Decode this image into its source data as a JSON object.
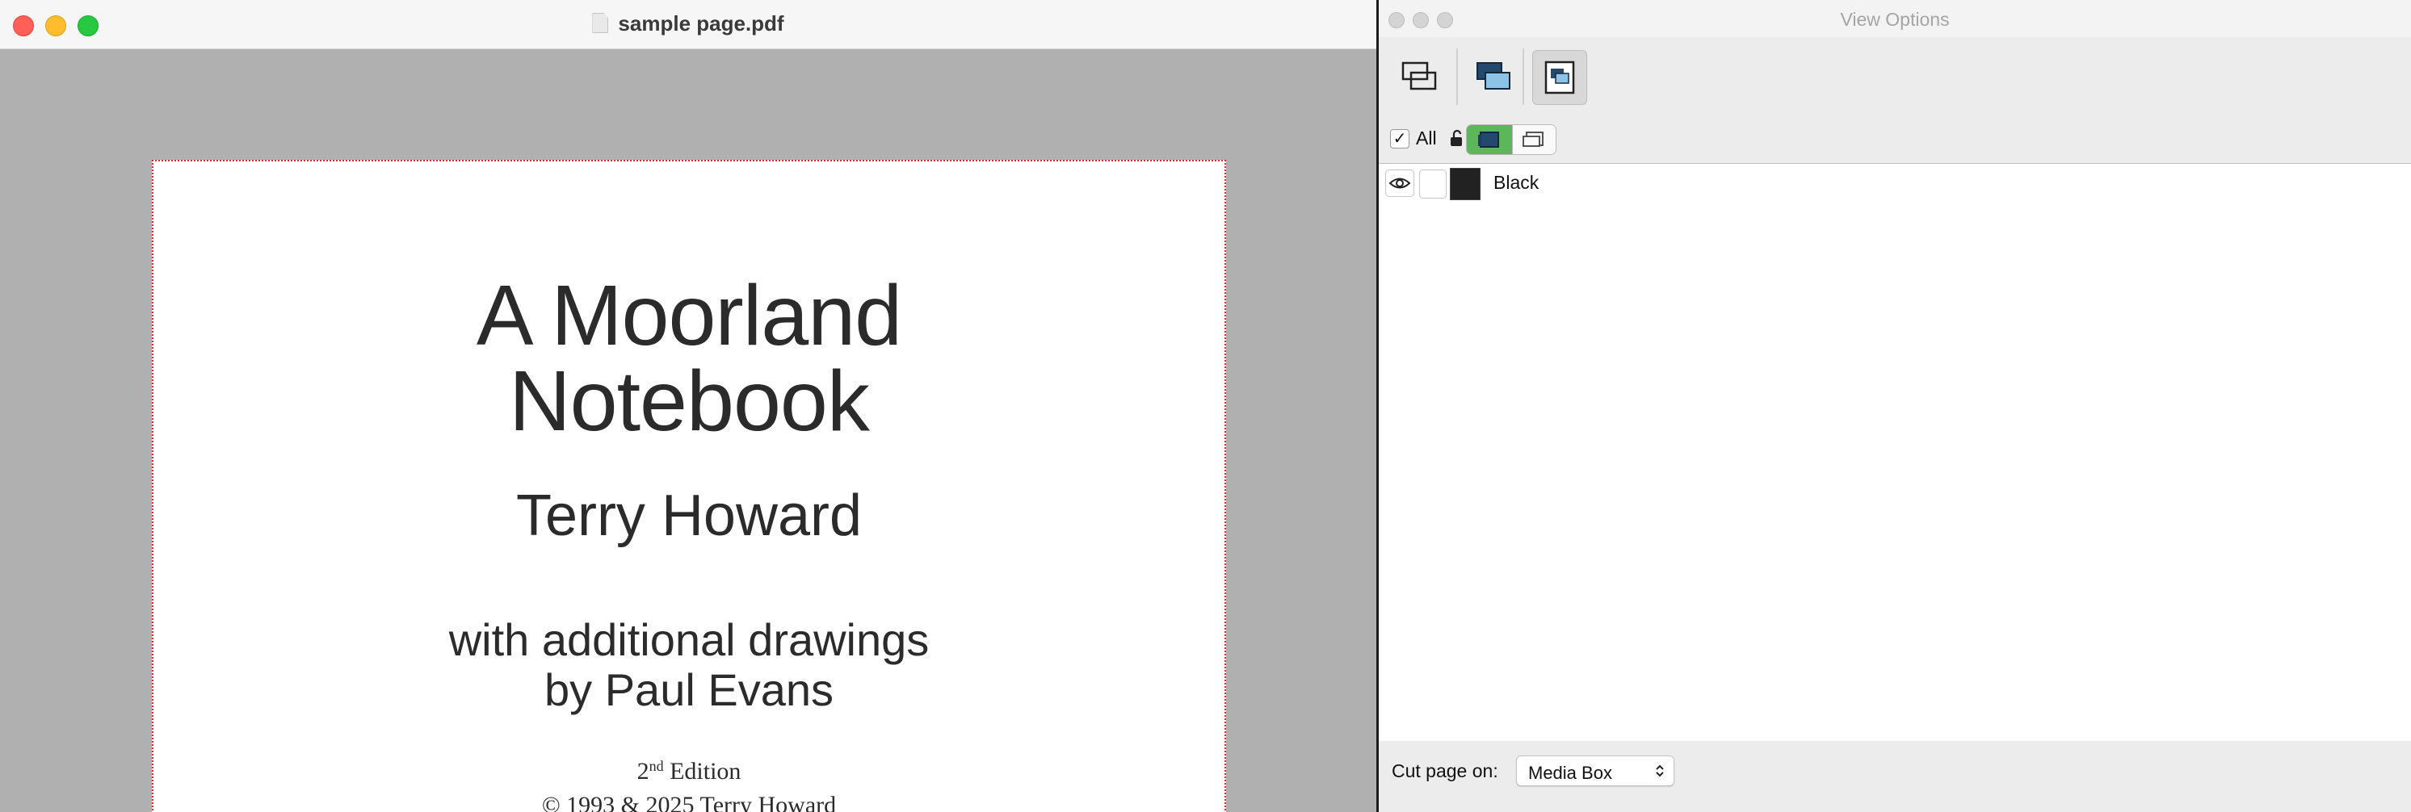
{
  "pdf_window": {
    "title": "sample page.pdf",
    "page": {
      "title_line1": "A Moorland",
      "title_line2": "Notebook",
      "author": "Terry Howard",
      "subtitle_line1": "with additional drawings",
      "subtitle_line2": "by Paul Evans",
      "edition_number": "2",
      "edition_suffix": "nd",
      "edition_word": "Edition",
      "copyright": "© 1993 & 2025 Terry Howard"
    }
  },
  "view_options": {
    "title": "View Options",
    "toolbar_icons": [
      "outline-view-icon",
      "filled-view-icon",
      "selected-view-icon"
    ],
    "filter": {
      "all_label": "All",
      "all_checked": true,
      "check_mark": "✓"
    },
    "layers": [
      {
        "name": "Black",
        "swatch_color": "#222222",
        "visible": true
      }
    ],
    "cut_page_label": "Cut page on:",
    "cut_page_value": "Media Box"
  },
  "colors": {
    "accent_green": "#5cb65a",
    "page_border": "#d92b2b",
    "canvas_gray": "#b0b0b0"
  }
}
